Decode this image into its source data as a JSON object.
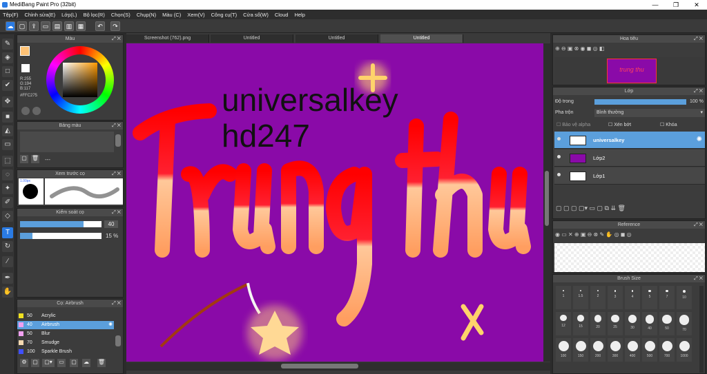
{
  "window": {
    "title": "MediBang Paint Pro (32bit)"
  },
  "menu": [
    "Tệp(F)",
    "Chỉnh sửa(E)",
    "Lớp(L)",
    "Bộ lọc(R)",
    "Chọn(S)",
    "Chụp(N)",
    "Màu (C)",
    "Xem(V)",
    "Công cụ(T)",
    "Cửa sổ(W)",
    "Cloud",
    "Help"
  ],
  "tabs": [
    "Screenshot (762).png",
    "Untitled",
    "Untitled",
    "Untitled"
  ],
  "color_panel": {
    "title": "Màu",
    "r": "R:255",
    "g": "G:194",
    "b": "B:117",
    "hex": "#FFC275",
    "fg": "#FFC275"
  },
  "palette_panel": {
    "title": "Bảng màu",
    "extra": "---"
  },
  "brush_preview": {
    "title": "Xem trước cọ",
    "size": "1.00px"
  },
  "brush_control": {
    "title": "Kiểm soát cọ",
    "size": "40",
    "opacity": "15 %"
  },
  "brush_list": {
    "title": "Cọ: Airbrush",
    "items": [
      {
        "size": "50",
        "name": "Acrylic",
        "color": "#f0e020"
      },
      {
        "size": "40",
        "name": "Airbrush",
        "color": "#f0a0f0"
      },
      {
        "size": "50",
        "name": "Blur",
        "color": "#f0a0f0"
      },
      {
        "size": "70",
        "name": "Smudge",
        "color": "#f5d9b0"
      },
      {
        "size": "100",
        "name": "Sparkle Brush",
        "color": "#4050ff"
      }
    ],
    "selected": 1
  },
  "navigator": {
    "title": "Hoa tiêu"
  },
  "layer_panel": {
    "title": "Lớp",
    "opacity_label": "Độ trong",
    "opacity_value": "100 %",
    "opacity_fraction": 1.0,
    "blend_label": "Pha trộn",
    "blend_value": "Bình thường",
    "protect_alpha": "Bảo vệ alpha",
    "clipping": "Xén bớt",
    "lock": "Khóa",
    "layers": [
      "universalkey",
      "Lớp2",
      "Lớp1"
    ],
    "selected": 0
  },
  "reference": {
    "title": "Reference"
  },
  "brush_size": {
    "title": "Brush Size",
    "sizes": [
      "1",
      "1.5",
      "2",
      "3",
      "4",
      "5",
      "7",
      "10",
      "12",
      "15",
      "20",
      "25",
      "30",
      "40",
      "50",
      "70",
      "100",
      "150",
      "200",
      "300",
      "400",
      "500",
      "700",
      "1000"
    ]
  },
  "artwork": {
    "watermark_line1": "universalkey",
    "watermark_line2": "hd247",
    "lettering": "Trung thu"
  }
}
